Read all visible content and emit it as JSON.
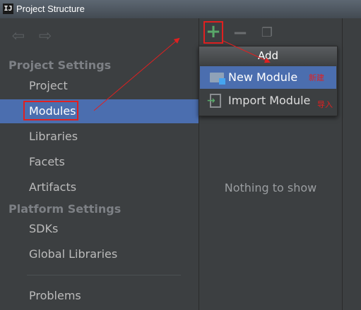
{
  "window": {
    "title": "Project Structure",
    "app_icon": "IJ"
  },
  "nav": {
    "back_icon": "arrow-left-icon",
    "forward_icon": "arrow-right-icon"
  },
  "sections": {
    "project_settings": "Project Settings",
    "platform_settings": "Platform Settings"
  },
  "items": {
    "project": "Project",
    "modules": "Modules",
    "libraries": "Libraries",
    "facets": "Facets",
    "artifacts": "Artifacts",
    "sdks": "SDKs",
    "global_libraries": "Global Libraries",
    "problems": "Problems"
  },
  "toolbar": {
    "add": "+",
    "remove": "−"
  },
  "main": {
    "empty_text": "Nothing to show"
  },
  "popup": {
    "header": "Add",
    "new_module": "New Module",
    "new_module_note": "新建",
    "import_module": "Import Module",
    "import_module_note": "导入"
  },
  "colors": {
    "selection": "#4b6eaf",
    "annotation": "#e02020",
    "add_green": "#59a869"
  }
}
